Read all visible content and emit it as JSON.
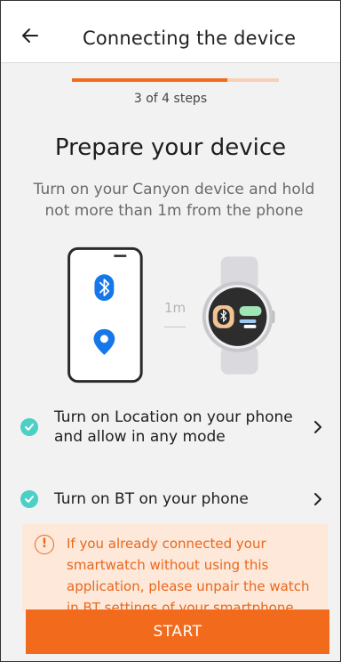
{
  "appbar": {
    "title": "Connecting the device"
  },
  "progress": {
    "current": 3,
    "total": 4,
    "fraction": 0.75,
    "label": "3 of 4 steps"
  },
  "main": {
    "heading": "Prepare your device",
    "subtitle": "Turn on your Canyon device and hold not more than 1m from the phone",
    "distance": "1m"
  },
  "steps": [
    {
      "label": "Turn on Location on your phone and allow in any mode",
      "done": true
    },
    {
      "label": "Turn on BT on your phone",
      "done": true
    }
  ],
  "warning": {
    "text": "If you already connected your smartwatch without using this application, please unpair the watch in BT settings of your smartphone"
  },
  "actions": {
    "start_label": "START"
  },
  "colors": {
    "accent": "#f26a1b",
    "check": "#4ccfc5",
    "warning_bg": "#fde8d9",
    "bluetooth": "#1677e8"
  },
  "icons": [
    "back-arrow-icon",
    "bluetooth-icon",
    "location-pin-icon",
    "check-icon",
    "chevron-right-icon",
    "warning-icon"
  ]
}
